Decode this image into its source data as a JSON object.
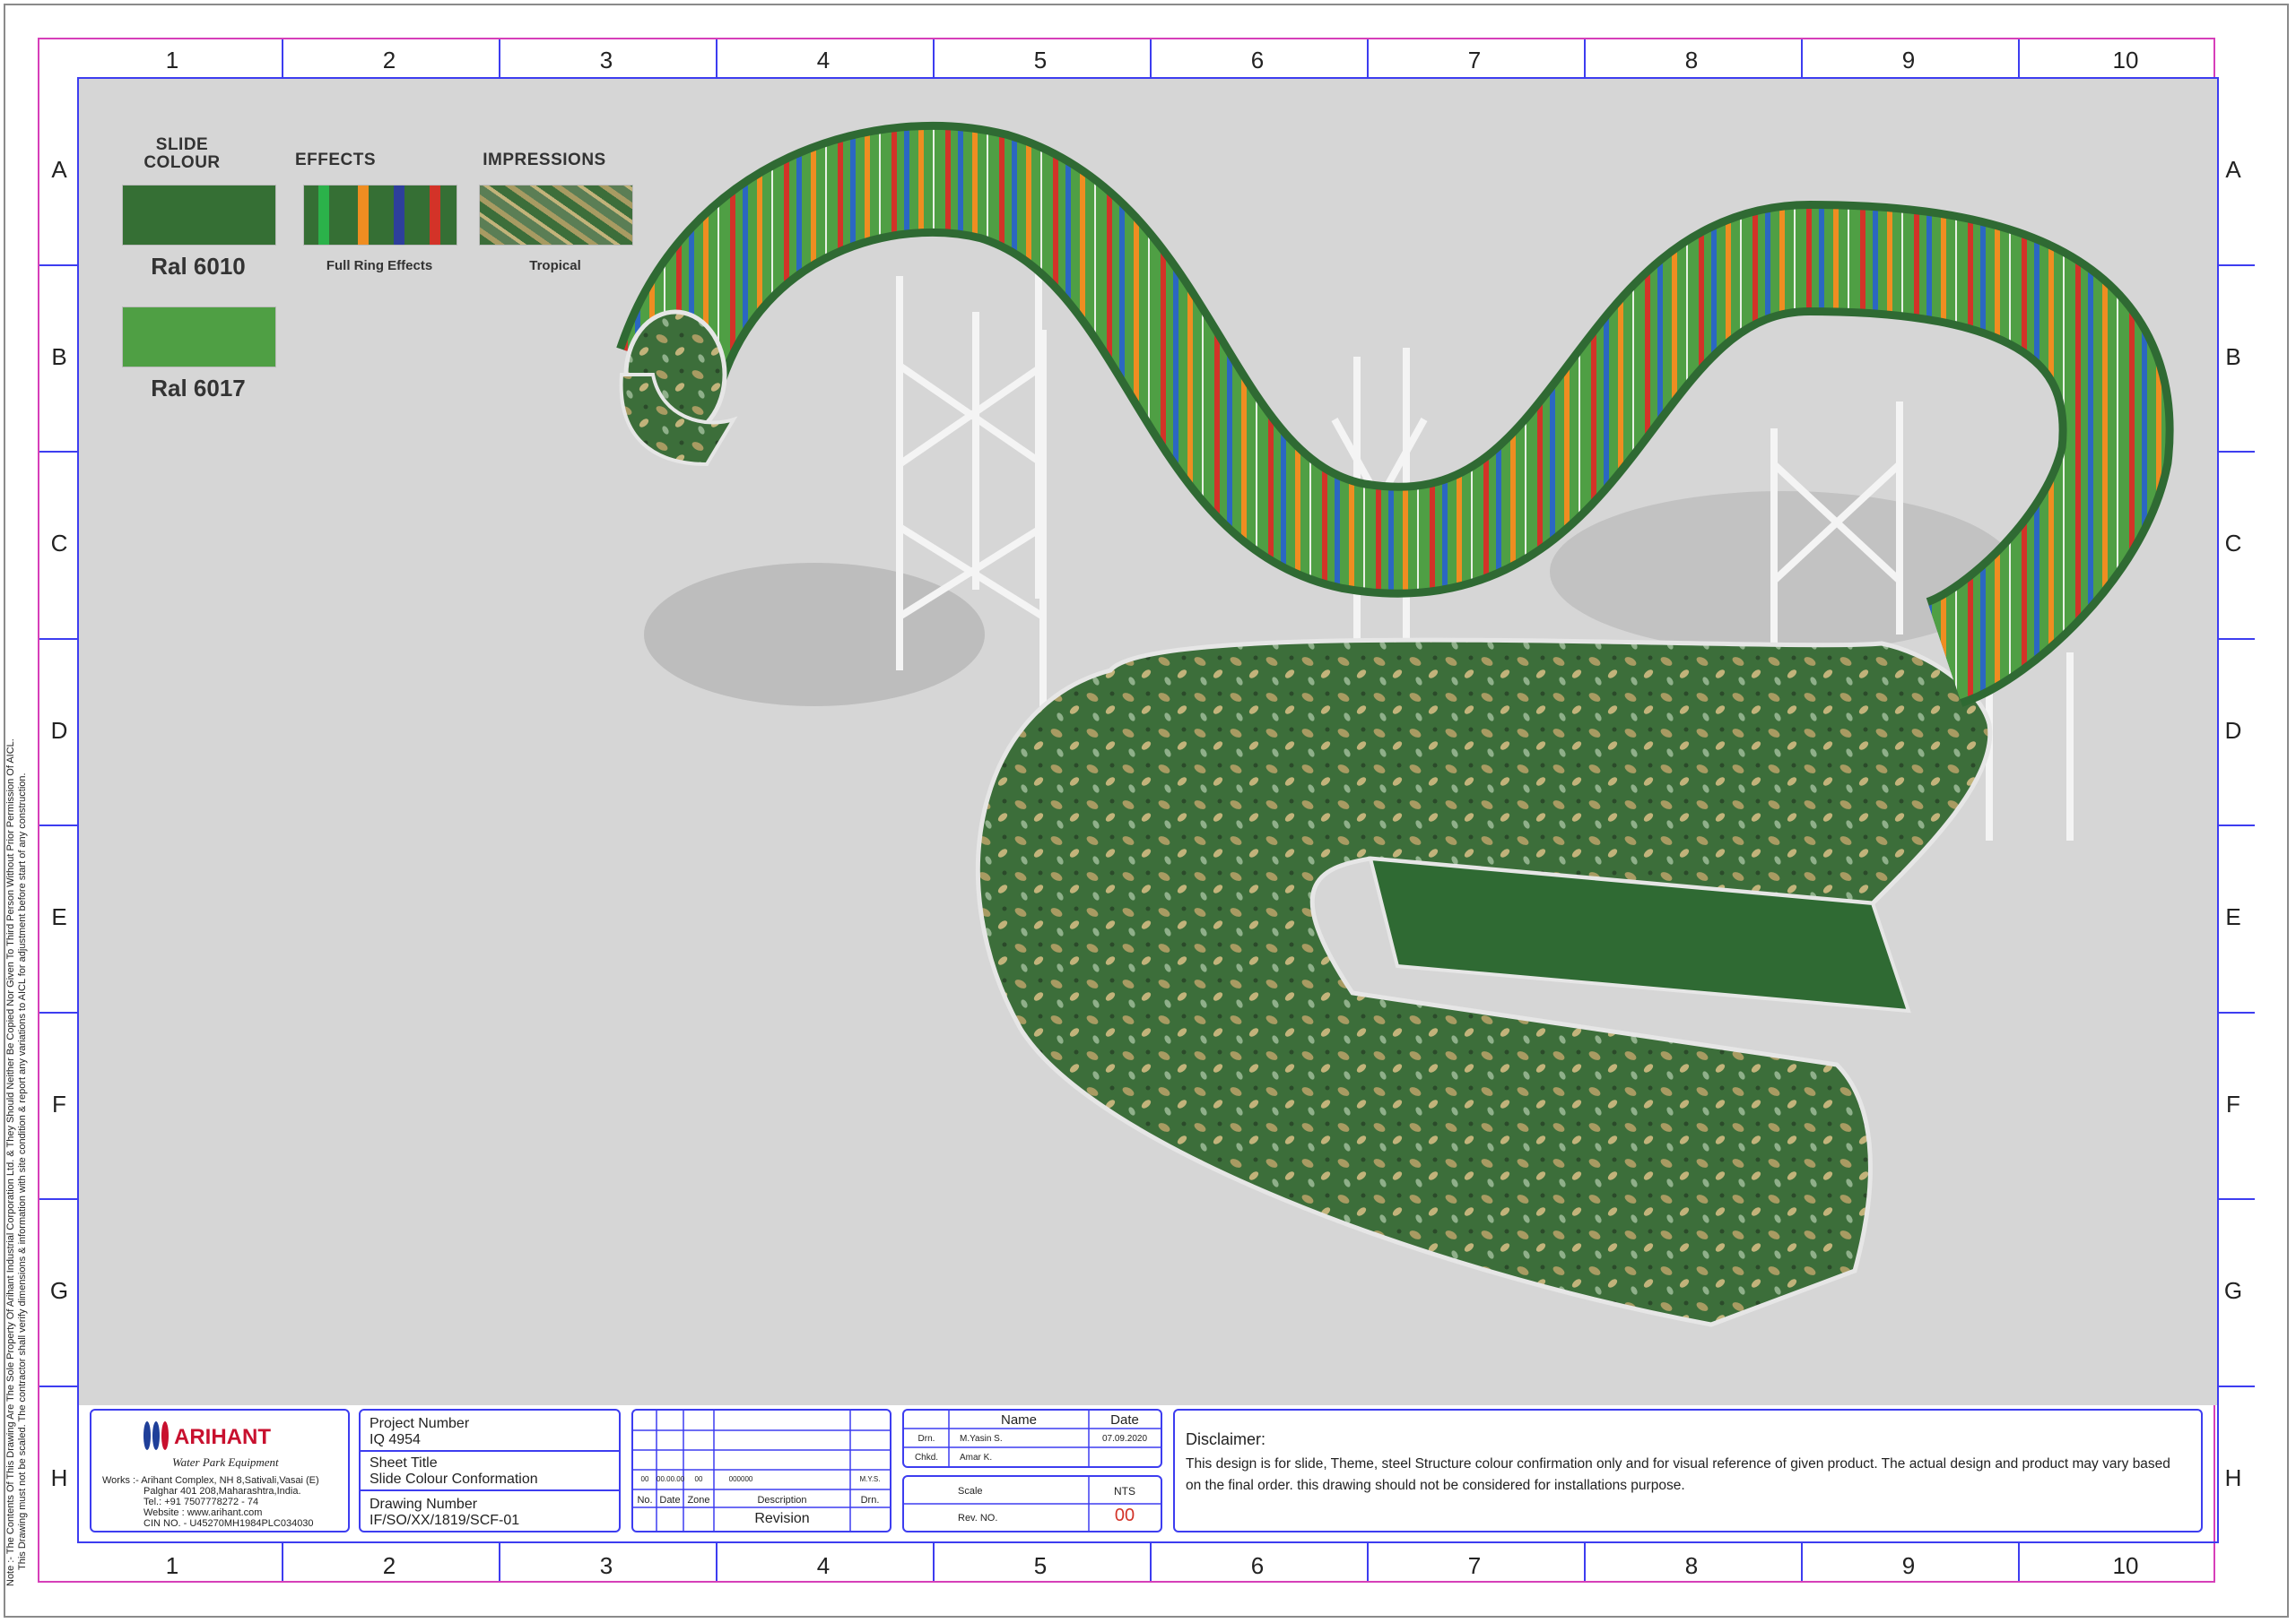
{
  "zones": {
    "columns": [
      "1",
      "2",
      "3",
      "4",
      "5",
      "6",
      "7",
      "8",
      "9",
      "10"
    ],
    "rows": [
      "A",
      "B",
      "C",
      "D",
      "E",
      "F",
      "G",
      "H"
    ]
  },
  "side_note": {
    "line1": "Note :- The Contents Of This Drawing Are The Sole Property Of Arihant Industrial Corporation Ltd. & They Should Neither Be Copied Nor Given To Third Person Without Prior Permission Of AICL.",
    "line2": "This Drawing must not be scaled. The contractor shall verify dimensions & information with site condition & report any variations to AICL for adjustment before start of any construction."
  },
  "legend": {
    "slide_colour_heading": "SLIDE COLOUR",
    "effects_heading": "EFFECTS",
    "impressions_heading": "IMPRESSIONS",
    "colour_1": {
      "label": "Ral 6010",
      "hex": "#356f34"
    },
    "colour_2": {
      "label": "Ral 6017",
      "hex": "#4f9f44"
    },
    "effect_label": "Full Ring Effects",
    "impression_label": "Tropical"
  },
  "colors": {
    "canvas": "#d6d6d6",
    "slide_dark": "#356f34",
    "slide_light": "#4f9f44",
    "ring_red": "#d33328",
    "ring_orange": "#ef8d21",
    "ring_blue": "#2b67c2",
    "steel": "#f2f2f2",
    "border_blue": "#3d3df0",
    "border_pink": "#d63fb9",
    "brand_red": "#c8102e",
    "brand_blue": "#1f3f99"
  },
  "company": {
    "logo_text": "ARIHANT",
    "tagline": "Water Park Equipment",
    "address_1": "Works :- Arihant Complex, NH 8,Sativali,Vasai (E)",
    "address_2": "Palghar  401 208,Maharashtra,India.",
    "tel": "Tel.: +91 7507778272 - 74",
    "website": "Website : www.arihant.com",
    "cin": "CIN NO. - U45270MH1984PLC034030"
  },
  "project": {
    "number_label": "Project Number",
    "number": "IQ 4954",
    "sheet_title_label": "Sheet Title",
    "sheet_title": "Slide Colour Conformation",
    "drawing_number_label": "Drawing Number",
    "drawing_number": "IF/SO/XX/1819/SCF-01"
  },
  "revision": {
    "row_no": "00",
    "row_date": "00.00.00",
    "row_zone": "00",
    "row_desc": "000000",
    "row_drn": "M.Y.S.",
    "col_no": "No.",
    "col_date": "Date",
    "col_zone": "Zone",
    "col_desc": "Description",
    "col_drn": "Drn.",
    "title": "Revision"
  },
  "approval": {
    "name_header": "Name",
    "date_header": "Date",
    "drn_label": "Drn.",
    "drn_name": "M.Yasin S.",
    "drn_date": "07.09.2020",
    "chkd_label": "Chkd.",
    "chkd_name": "Amar K.",
    "scale_label": "Scale",
    "scale_value": "NTS",
    "rev_label": "Rev. NO.",
    "rev_value": "00"
  },
  "disclaimer": {
    "heading": "Disclaimer:",
    "body": "This design is for slide, Theme, steel Structure colour confirmation only and for visual reference of given product. The actual design and product may vary based on the final order. this drawing should not be considered for installations purpose."
  }
}
